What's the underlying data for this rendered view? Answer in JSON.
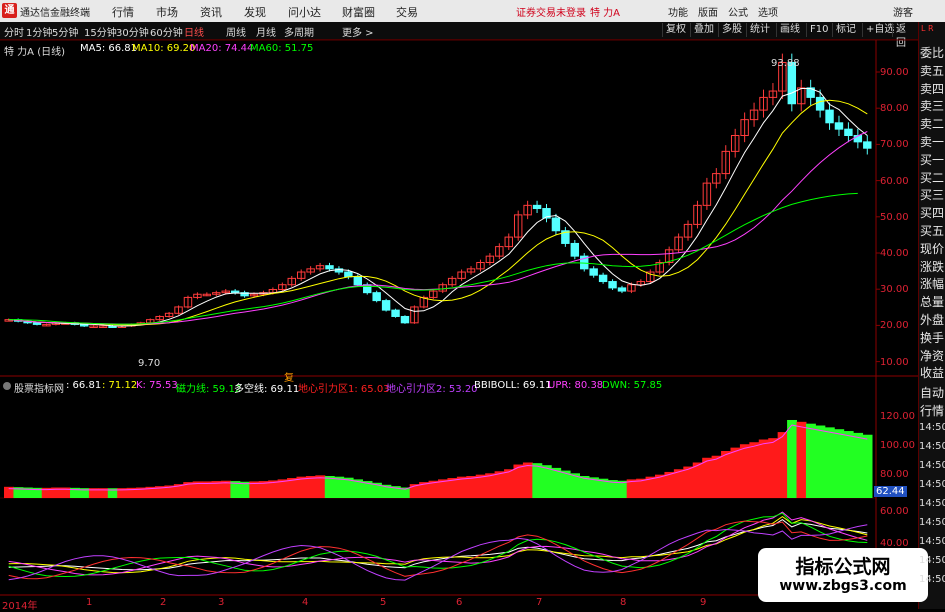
{
  "window": {
    "app_title": "通达信金融终端",
    "logo_glyph": "通"
  },
  "menu": [
    "行情",
    "市场",
    "资讯",
    "发现",
    "问小达",
    "财富圈",
    "交易"
  ],
  "notice": "证券交易未登录",
  "stock_header": "特 力A",
  "right_menu": [
    "功能",
    "版面",
    "公式",
    "选项"
  ],
  "account": "游客",
  "periods": [
    "分时",
    "1分钟",
    "5分钟",
    "15分钟",
    "30分钟",
    "60分钟",
    "日线",
    "周线",
    "月线",
    "多周期",
    "更多 >"
  ],
  "active_period": "日线",
  "toolbar_buttons": [
    "复权",
    "叠加",
    "多股",
    "统计",
    "画线",
    "F10",
    "标记",
    "+自选",
    "返回"
  ],
  "main_indicator": {
    "name": "特 力A (日线)",
    "ma": [
      {
        "label": "MA5: 66.81",
        "color": "#ffffff"
      },
      {
        "label": "MA10: 69.20",
        "color": "#ffff00"
      },
      {
        "label": "MA20: 74.44",
        "color": "#ff40ff"
      },
      {
        "label": "MA60: 51.75",
        "color": "#00ff00"
      }
    ]
  },
  "sub_indicator": {
    "name": "股票指标网",
    "items": [
      {
        "label": ": 66.81",
        "color": "#ffffff"
      },
      {
        "label": ": 71.12",
        "color": "#ffff00"
      },
      {
        "label": "K: 75.53",
        "color": "#ff40ff"
      },
      {
        "label": "磁力线: 59.12",
        "color": "#00ff00"
      },
      {
        "label": "多空线: 69.11",
        "color": "#ffffff"
      },
      {
        "label": "地心引力区1: 65.03",
        "color": "#ff2020"
      },
      {
        "label": "地心引力区2: 53.20",
        "color": "#c040ff"
      },
      {
        "label": "BBIBOLL: 69.11",
        "color": "#ffffff"
      },
      {
        "label": "UPR: 80.38",
        "color": "#ff40ff"
      },
      {
        "label": "DWN: 57.85",
        "color": "#00ff00"
      }
    ]
  },
  "side_labels": [
    "委比",
    "卖五",
    "卖四",
    "卖三",
    "卖二",
    "卖一",
    "买一",
    "买二",
    "买三",
    "买四",
    "买五",
    "现价",
    "涨跌",
    "涨幅",
    "总量",
    "外盘",
    "换手",
    "净资",
    "收益"
  ],
  "side_labels2": [
    "自动",
    "行情"
  ],
  "side_times": [
    "14:50",
    "14:50",
    "14:50",
    "14:50",
    "14:50",
    "14:50",
    "14:50",
    "14:50",
    "14:50"
  ],
  "side_corner": "L R",
  "markers": {
    "high": "93.88",
    "low": "9.70",
    "event": "复"
  },
  "sub_value_badge": "62.44",
  "time_axis": [
    "2014年",
    "1",
    "2",
    "3",
    "4",
    "5",
    "6",
    "7",
    "8",
    "9"
  ],
  "watermark": {
    "line1": "指标公式网",
    "line2": "www.zbgs3.com"
  },
  "chart_data": [
    {
      "type": "candlestick",
      "title": "特 力A (日线)",
      "ylim": [
        0,
        100
      ],
      "yticks": [
        "90.00",
        "80.00",
        "70.00",
        "60.00",
        "50.00",
        "40.00",
        "30.00",
        "20.00",
        "10.00"
      ],
      "series": [
        {
          "name": "close",
          "values": [
            12,
            11.5,
            11,
            10.5,
            10.5,
            11,
            11,
            10.5,
            10,
            10,
            10,
            9.9,
            10,
            10.5,
            11,
            12,
            13,
            14,
            16,
            19,
            20,
            20,
            20.5,
            21,
            20.5,
            19.5,
            20,
            20.5,
            21.5,
            23,
            25,
            27,
            28,
            29,
            28,
            27,
            25.5,
            23,
            20.5,
            18,
            15,
            13,
            11,
            16,
            19,
            21,
            23,
            25,
            27,
            28,
            30,
            32,
            35,
            38,
            45,
            48,
            47,
            44,
            40,
            36,
            32,
            28,
            26,
            24,
            22,
            21,
            23,
            24,
            27,
            30,
            34,
            38,
            42,
            48,
            55,
            58,
            65,
            70,
            75,
            78,
            82,
            84,
            93,
            80,
            85,
            82,
            78,
            74,
            72,
            70,
            68,
            66
          ]
        },
        {
          "name": "MA60",
          "values": [
            12,
            12,
            11.9,
            11.8,
            11.6,
            11.4,
            11.2,
            11,
            10.9,
            10.8,
            10.7,
            10.6,
            10.6,
            10.6,
            10.7,
            10.9,
            11.2,
            11.5,
            11.9,
            12.4,
            12.9,
            13.4,
            13.9,
            14.4,
            14.9,
            15.3,
            15.7,
            16.1,
            16.6,
            17.2,
            17.9,
            18.7,
            19.5,
            20.3,
            21,
            21.6,
            22.1,
            22.4,
            22.5,
            22.4,
            22.2,
            21.9,
            21.5,
            21.3,
            21.3,
            21.4,
            21.7,
            22,
            22.5,
            23,
            23.6,
            24.2,
            24.9,
            25.7,
            26.6,
            27.5,
            28.3,
            29,
            29.5,
            29.8,
            29.9,
            29.8,
            29.6,
            29.3,
            29,
            28.8,
            28.7,
            28.8,
            29.1,
            29.6,
            30.3,
            31.2,
            32.3,
            33.7,
            35.3,
            36.9,
            38.6,
            40.3,
            41.9,
            43.4,
            44.8,
            46.1,
            47.3,
            48.3,
            49.1,
            49.8,
            50.4,
            50.9,
            51.3,
            51.6,
            51.75
          ]
        }
      ]
    },
    {
      "type": "bar",
      "title": "股票指标网",
      "ylim": [
        60,
        130
      ],
      "yticks": [
        "120.00",
        "100.00",
        "80.00"
      ]
    },
    {
      "type": "line",
      "ylim": [
        30,
        70
      ],
      "yticks": [
        "60.00",
        "40.00"
      ]
    }
  ]
}
